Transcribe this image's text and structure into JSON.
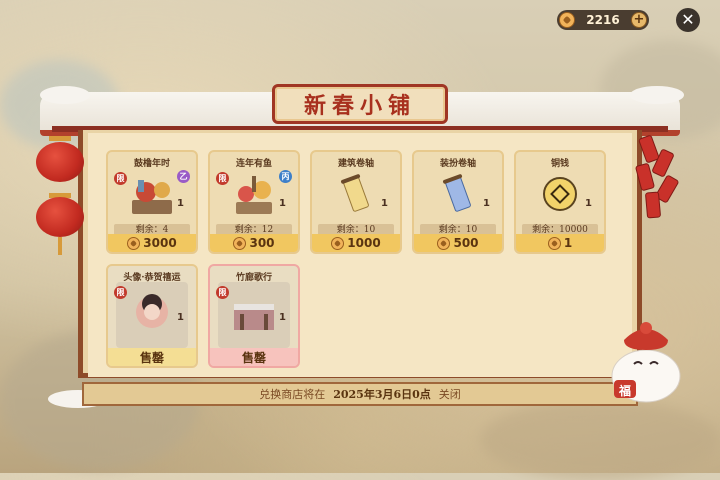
{
  "currency": {
    "amount": "2216",
    "icon": "coin-icon"
  },
  "shop": {
    "title": "新春小铺"
  },
  "items": [
    {
      "name": "鼓橹年时",
      "qty": "1",
      "remain": "剩余：4",
      "price": "3000",
      "limited": "限",
      "tag": "乙"
    },
    {
      "name": "连年有鱼",
      "qty": "1",
      "remain": "剩余：12",
      "price": "300",
      "limited": "限",
      "tag": "丙"
    },
    {
      "name": "建筑卷轴",
      "qty": "1",
      "remain": "剩余：10",
      "price": "1000"
    },
    {
      "name": "装扮卷轴",
      "qty": "1",
      "remain": "剩余：10",
      "price": "500"
    },
    {
      "name": "铜钱",
      "qty": "1",
      "remain": "剩余：10000",
      "price": "1"
    }
  ],
  "sold_items": [
    {
      "name": "头像·恭贺禧运",
      "qty": "1",
      "status": "售罄",
      "limited": "限"
    },
    {
      "name": "竹廊歌行",
      "qty": "1",
      "status": "售罄",
      "limited": "限"
    }
  ],
  "footer": {
    "prefix": "兑换商店将在",
    "date": "2025年3月6日0点",
    "suffix": "关闭"
  },
  "mascot": {
    "sign": "福"
  },
  "colors": {
    "accent": "#a8301e",
    "price_bg": "#f1c760",
    "frame": "#8e4b29"
  }
}
